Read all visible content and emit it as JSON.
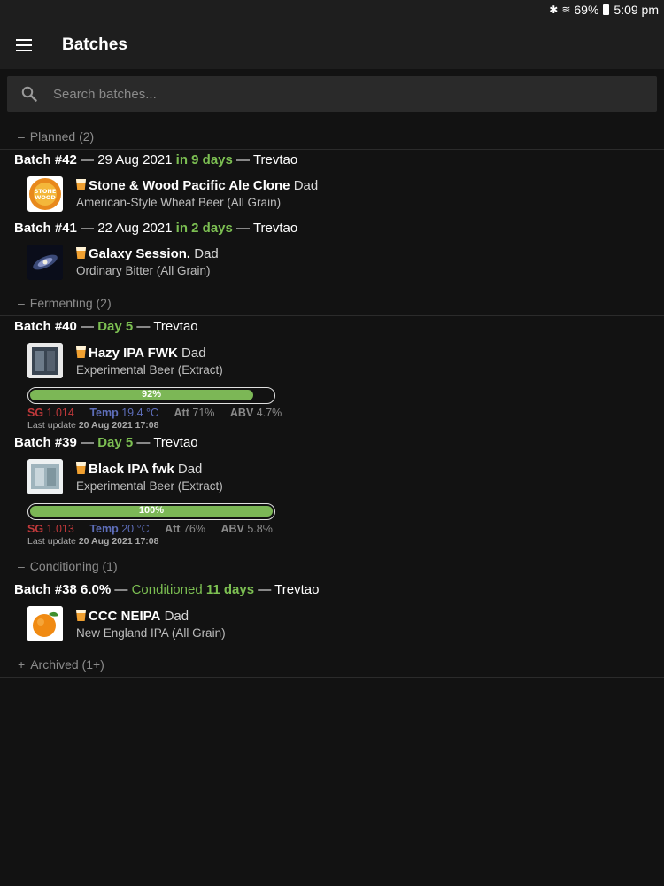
{
  "status_bar": {
    "bluetooth_icon": "bluetooth-icon",
    "wifi_icon": "wifi-icon",
    "battery": "69%",
    "time": "5:09 pm"
  },
  "app_bar": {
    "title": "Batches",
    "menu_icon": "hamburger-menu-icon"
  },
  "search": {
    "placeholder": "Search batches..."
  },
  "colors": {
    "accent_green": "#7cbf52",
    "sg_red": "#c0393b",
    "temp_blue": "#5d6db8",
    "background": "#121212",
    "toolbar": "#1e1e1e"
  },
  "groups": [
    {
      "label": "Planned (2)",
      "toggle": "–",
      "batches": [
        {
          "number": "Batch #42",
          "sep1": "—",
          "date": "29 Aug 2021",
          "status": "in 9 days",
          "sep2": "—",
          "brewer": "Trevtao",
          "recipe": {
            "name": "Stone & Wood Pacific Ale Clone",
            "owner": "Dad",
            "style": "American-Style Wheat Beer (All Grain)",
            "logo_text": "STONE WOOD"
          }
        },
        {
          "number": "Batch #41",
          "sep1": "—",
          "date": "22 Aug 2021",
          "status": "in 2 days",
          "sep2": "—",
          "brewer": "Trevtao",
          "recipe": {
            "name": "Galaxy Session.",
            "owner": "Dad",
            "style": "Ordinary Bitter (All Grain)"
          }
        }
      ]
    },
    {
      "label": "Fermenting (2)",
      "toggle": "–",
      "batches": [
        {
          "number": "Batch #40",
          "sep1": "—",
          "status": "Day 5",
          "sep2": "—",
          "brewer": "Trevtao",
          "recipe": {
            "name": "Hazy IPA FWK",
            "owner": "Dad",
            "style": "Experimental Beer (Extract)"
          },
          "progress": {
            "label": "92%",
            "value": 0.92
          },
          "readings": {
            "sg_label": "SG",
            "sg": "1.014",
            "temp_label": "Temp",
            "temp": "19.4 °C",
            "att_label": "Att",
            "att": "71%",
            "abv_label": "ABV",
            "abv": "4.7%"
          },
          "last_update": {
            "label": "Last update",
            "time": "20 Aug 2021 17:08"
          }
        },
        {
          "number": "Batch #39",
          "sep1": "—",
          "status": "Day 5",
          "sep2": "—",
          "brewer": "Trevtao",
          "recipe": {
            "name": "Black IPA fwk",
            "owner": "Dad",
            "style": "Experimental Beer (Extract)"
          },
          "progress": {
            "label": "100%",
            "value": 1.0
          },
          "readings": {
            "sg_label": "SG",
            "sg": "1.013",
            "temp_label": "Temp",
            "temp": "20 °C",
            "att_label": "Att",
            "att": "76%",
            "abv_label": "ABV",
            "abv": "5.8%"
          },
          "last_update": {
            "label": "Last update",
            "time": "20 Aug 2021 17:08"
          }
        }
      ]
    },
    {
      "label": "Conditioning (1)",
      "toggle": "–",
      "batches": [
        {
          "number": "Batch #38",
          "abv": "6.0%",
          "sep1": "—",
          "status_prefix": "Conditioned",
          "status": "11 days",
          "sep2": "—",
          "brewer": "Trevtao",
          "recipe": {
            "name": "CCC NEIPA",
            "owner": "Dad",
            "style": "New England IPA (All Grain)"
          }
        }
      ]
    },
    {
      "label": "Archived (1+)",
      "toggle": "+"
    }
  ]
}
